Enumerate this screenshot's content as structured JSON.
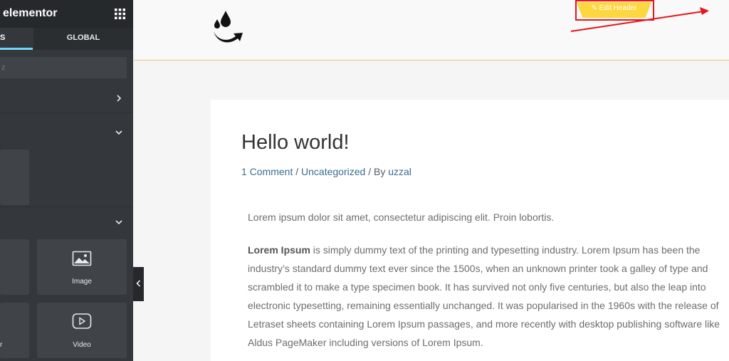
{
  "panel": {
    "brand": "elementor",
    "tabs": [
      {
        "label": "S"
      },
      {
        "label": "GLOBAL"
      }
    ],
    "search": {
      "placeholder": "z",
      "value": ""
    },
    "widgets": [
      {
        "label": "Image",
        "icon": "image-icon"
      },
      {
        "label": "Video",
        "icon": "video-icon"
      },
      {
        "label": "r"
      }
    ],
    "colors": {
      "panel_bg": "#34383c",
      "accent": "#71d7f7"
    }
  },
  "site": {
    "edit_header_label": "Edit Header",
    "colors": {
      "edit_header": "#fdd73f",
      "highlight": "#e5161c"
    }
  },
  "post": {
    "title": "Hello world!",
    "meta": {
      "comments": "1 Comment",
      "sep1": " / ",
      "category": "Uncategorized",
      "sep2": " / By ",
      "author": "uzzal"
    },
    "paragraph1": "Lorem ipsum dolor sit amet, consectetur adipiscing elit. Proin lobortis.",
    "paragraph2_bold": "Lorem Ipsum",
    "paragraph2_rest": " is simply dummy text of the printing and typesetting industry. Lorem Ipsum has been the industry’s standard dummy text ever since the 1500s, when an unknown printer took a galley of type and scrambled it to make a type specimen book. It has survived not only five centuries, but also the leap into electronic typesetting, remaining essentially unchanged. It was popularised in the 1960s with the release of Letraset sheets containing Lorem Ipsum passages, and more recently with desktop publishing software like Aldus PageMaker including versions of Lorem Ipsum."
  }
}
